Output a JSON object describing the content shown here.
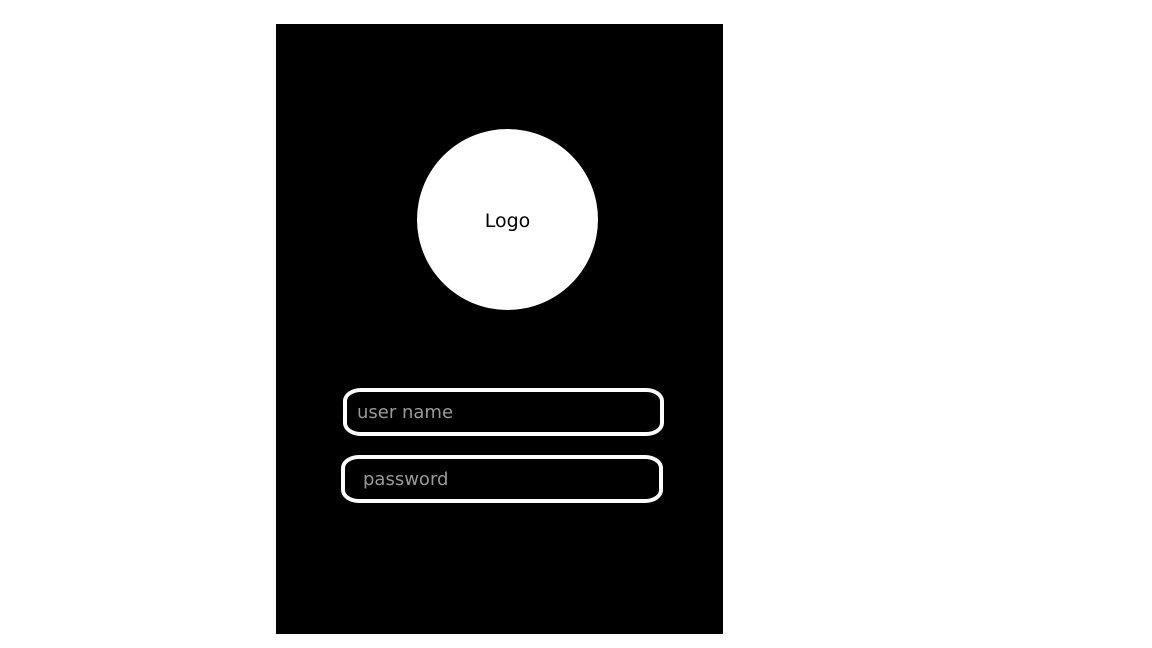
{
  "logo": {
    "text": "Logo"
  },
  "login_form": {
    "username": {
      "placeholder": "user name",
      "value": ""
    },
    "password": {
      "placeholder": "password",
      "value": ""
    }
  },
  "colors": {
    "page_background": "#ffffff",
    "panel_background": "#000000",
    "logo_background": "#ffffff",
    "field_border": "#ffffff",
    "placeholder_text": "#9a9a9a"
  }
}
